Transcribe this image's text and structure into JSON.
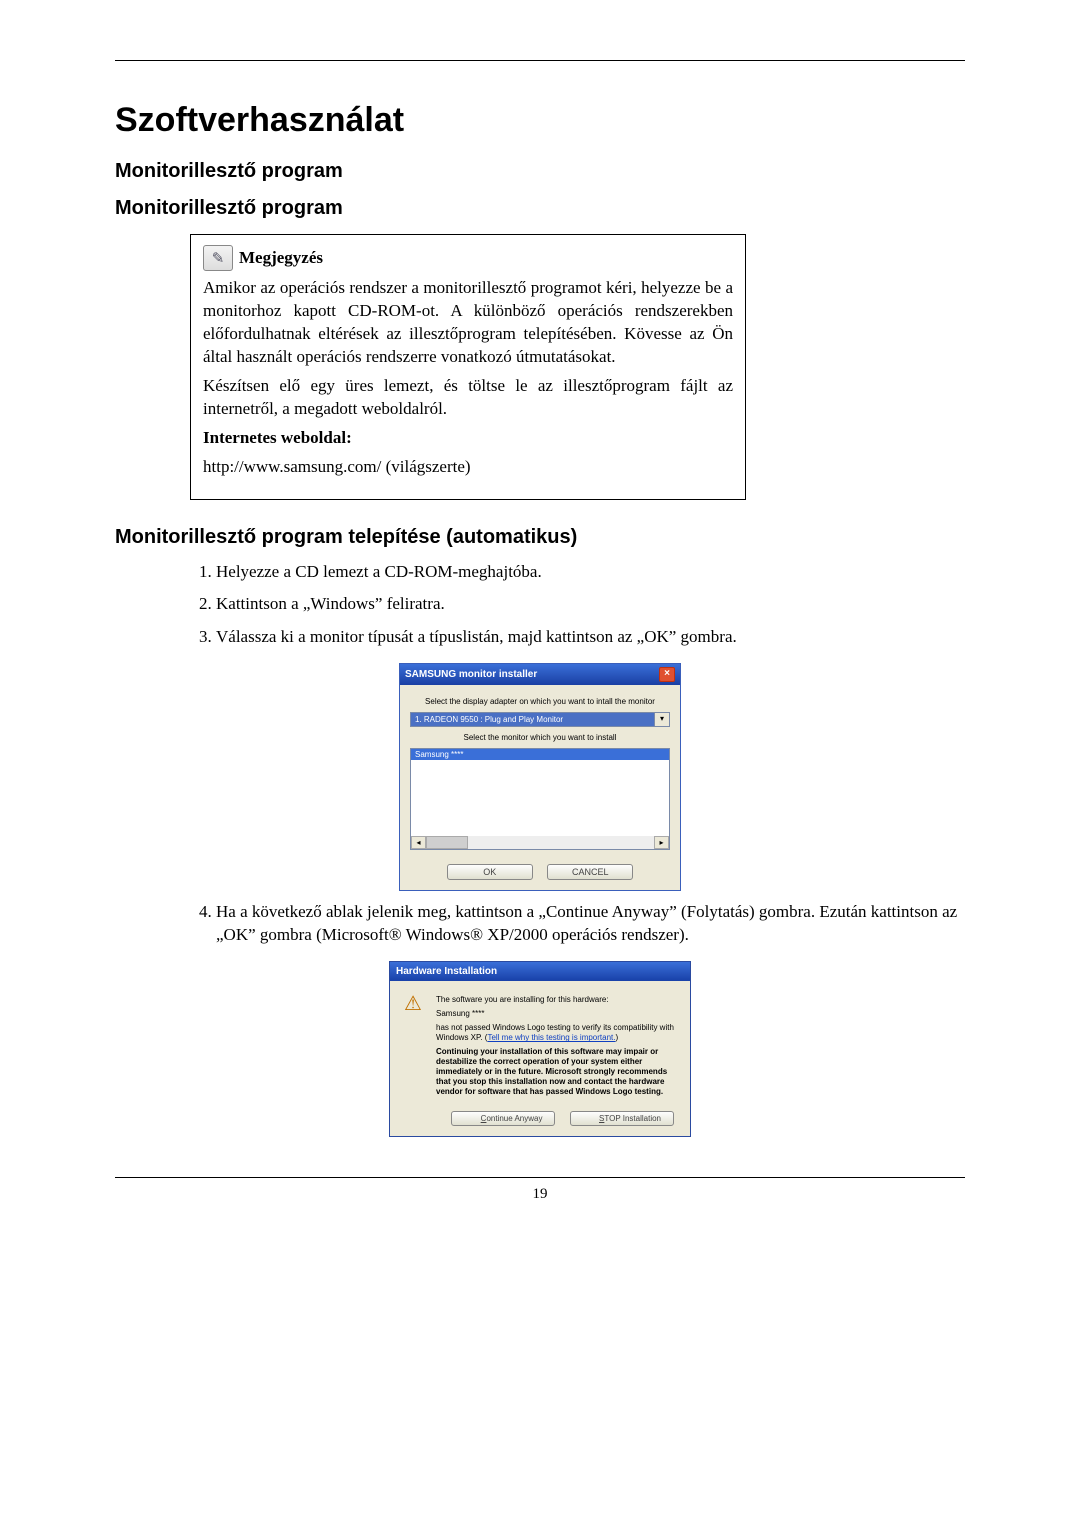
{
  "page_number": "19",
  "h1": "Szoftverhasználat",
  "sub1": "Monitorillesztő program",
  "sub2": "Monitorillesztő program",
  "note": {
    "title": "Megjegyzés",
    "p1": "Amikor az operációs rendszer a monitorillesztő programot kéri, helyezze be a monitorhoz kapott CD-ROM-ot. A különböző operációs rendszerekben előfordulhatnak eltérések az illesztőprogram telepítésében. Kövesse az Ön által használt operációs rendszerre vonatkozó útmutatásokat.",
    "p2": "Készítsen elő egy üres lemezt, és töltse le az illesztőprogram fájlt az internetről, a megadott weboldalról.",
    "site_label": "Internetes weboldal:",
    "site": "http://www.samsung.com/ (világszerte)"
  },
  "h_install": "Monitorillesztő program telepítése (automatikus)",
  "steps": {
    "s1": "Helyezze a CD lemezt a CD-ROM-meghajtóba.",
    "s2": "Kattintson a „Windows” feliratra.",
    "s3": "Válassza ki a monitor típusát a típuslistán, majd kattintson az „OK” gombra.",
    "s4": "Ha a következő ablak jelenik meg, kattintson a „Continue Anyway” (Folytatás) gombra. Ezután kattintson az „OK” gombra (Microsoft® Windows® XP/2000 operációs rendszer)."
  },
  "installer": {
    "title": "SAMSUNG monitor installer",
    "close": "×",
    "label1": "Select the display adapter on which you want to intall the monitor",
    "dropdown": "1. RADEON 9550 : Plug and Play Monitor",
    "label2": "Select the monitor which you want to install",
    "list_selected": "Samsung ****",
    "ok": "OK",
    "cancel": "CANCEL"
  },
  "hw": {
    "title": "Hardware Installation",
    "line1": "The software you are installing for this hardware:",
    "device": "Samsung ****",
    "line2a": "has not passed Windows Logo testing to verify its compatibility with Windows XP. (",
    "link": "Tell me why this testing is important.",
    "line2b": ")",
    "warn": "Continuing your installation of this software may impair or destabilize the correct operation of your system either immediately or in the future. Microsoft strongly recommends that you stop this installation now and contact the hardware vendor for software that has passed Windows Logo testing.",
    "cont": "Continue Anyway",
    "stop": "STOP Installation"
  }
}
